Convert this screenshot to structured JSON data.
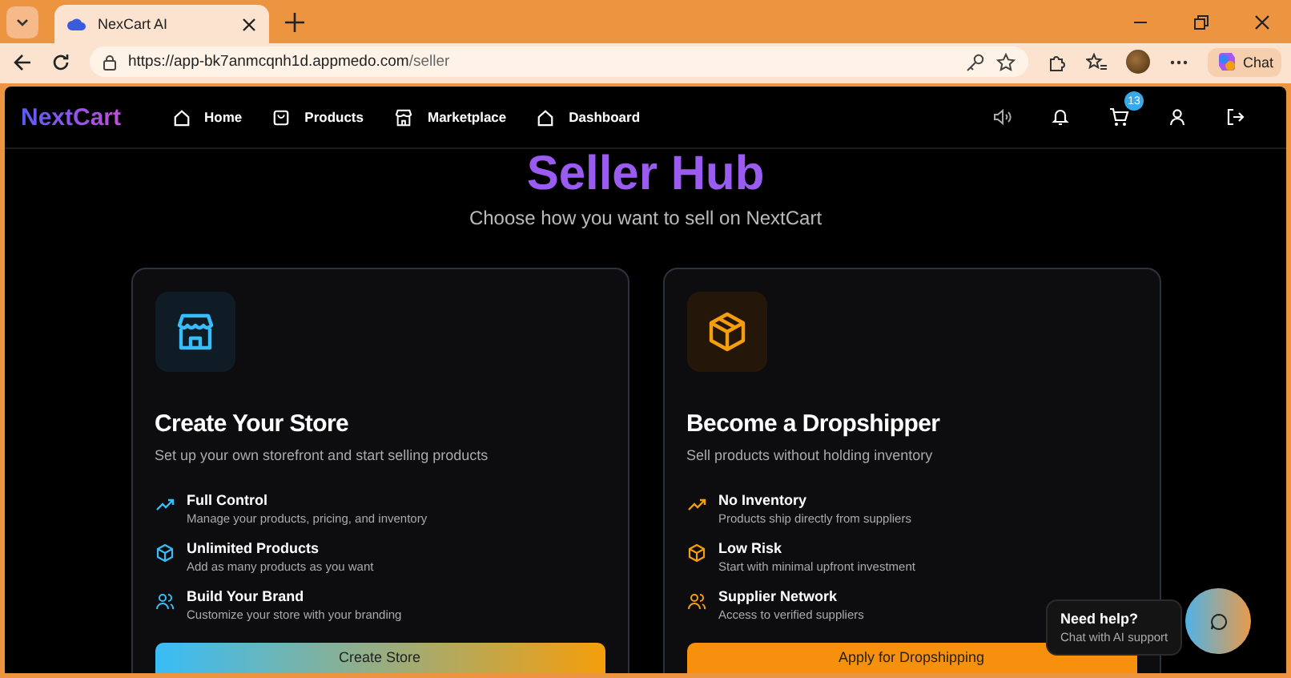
{
  "browser": {
    "tab_title": "NexCart AI",
    "url_host": "https://app-bk7anmcqnh1d.appmedo.com",
    "url_path": "/seller",
    "chat_label": "Chat"
  },
  "nav": {
    "logo": "NextCart",
    "items": [
      {
        "label": "Home",
        "kind": "home"
      },
      {
        "label": "Products",
        "kind": "bag"
      },
      {
        "label": "Marketplace",
        "kind": "store"
      },
      {
        "label": "Dashboard",
        "kind": "home"
      }
    ],
    "cart_count": "13"
  },
  "hero": {
    "title": "Seller Hub",
    "subtitle": "Choose how you want to sell on NextCart"
  },
  "cards": [
    {
      "kind": "store",
      "title": "Create Your Store",
      "subtitle": "Set up your own storefront and start selling products",
      "features": [
        {
          "kind": "trend",
          "title": "Full Control",
          "text": "Manage your products, pricing, and inventory"
        },
        {
          "kind": "box",
          "title": "Unlimited Products",
          "text": "Add as many products as you want"
        },
        {
          "kind": "users",
          "title": "Build Your Brand",
          "text": "Customize your store with your branding"
        }
      ],
      "button": "Create Store"
    },
    {
      "kind": "dropship",
      "title": "Become a Dropshipper",
      "subtitle": "Sell products without holding inventory",
      "features": [
        {
          "kind": "trend",
          "title": "No Inventory",
          "text": "Products ship directly from suppliers"
        },
        {
          "kind": "box",
          "title": "Low Risk",
          "text": "Start with minimal upfront investment"
        },
        {
          "kind": "users",
          "title": "Supplier Network",
          "text": "Access to verified suppliers"
        }
      ],
      "button": "Apply for Dropshipping"
    }
  ],
  "help": {
    "title": "Need help?",
    "text": "Chat with AI support"
  }
}
